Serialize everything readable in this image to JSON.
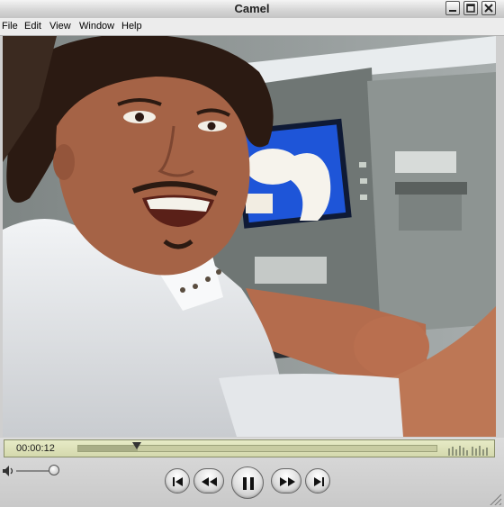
{
  "window": {
    "title": "Camel"
  },
  "title_buttons": [
    {
      "name": "minimize",
      "icon": "minimize-icon"
    },
    {
      "name": "maximize",
      "icon": "maximize-icon"
    },
    {
      "name": "close",
      "icon": "close-icon"
    }
  ],
  "menu": {
    "items": [
      "File",
      "Edit",
      "View",
      "Window",
      "Help"
    ]
  },
  "player": {
    "time": "00:00:12",
    "progress_fraction": 0.165,
    "volume_fraction": 0.92,
    "state": "playing"
  },
  "controls": {
    "buttons": [
      {
        "name": "go-to-start",
        "icon": "skip-back-icon"
      },
      {
        "name": "rewind",
        "icon": "rewind-icon"
      },
      {
        "name": "pause",
        "icon": "pause-icon"
      },
      {
        "name": "fast-forward",
        "icon": "fast-forward-icon"
      },
      {
        "name": "go-to-end",
        "icon": "skip-forward-icon"
      }
    ]
  },
  "colors": {
    "lcd": "#dde2bb",
    "chrome": "#d0d0d0",
    "atm_screen": "#1e55d8"
  }
}
